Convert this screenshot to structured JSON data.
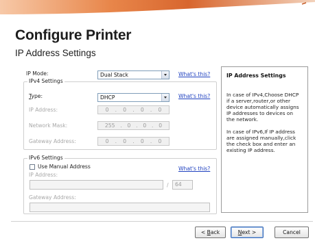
{
  "page": {
    "title": "Configure Printer",
    "subtitle": "IP Address Settings"
  },
  "ip_mode": {
    "label": "IP Mode:",
    "value": "Dual Stack",
    "help_link": "What's this?"
  },
  "ipv4": {
    "group_title": "IPv4 Settings",
    "type_label": "Type:",
    "type_value": "DHCP",
    "help_link": "What's this?",
    "ip_address_label": "IP Address:",
    "ip_address": [
      "0",
      "0",
      "0",
      "0"
    ],
    "netmask_label": "Network Mask:",
    "netmask": [
      "255",
      "0",
      "0",
      "0"
    ],
    "gateway_label": "Gateway Address:",
    "gateway": [
      "0",
      "0",
      "0",
      "0"
    ]
  },
  "ipv6": {
    "group_title": "IPv6 Settings",
    "manual_label": "Use Manual Address",
    "manual_checked": false,
    "help_link": "What's this?",
    "ip_address_label": "IP Address:",
    "ip_address_value": "",
    "prefix_separator": "/",
    "prefix_value": "64",
    "gateway_label": "Gateway Address:",
    "gateway_value": ""
  },
  "info": {
    "title": "IP Address Settings",
    "para1": "In case of IPv4,Choose DHCP if a server,router,or other device automatically assigns IP addresses to devices on the network.",
    "para2": "In case of IPv6,If IP address are assigned manually,click the check box and enter an existing IP address."
  },
  "footer": {
    "back": "< Back",
    "next": "Next >",
    "cancel": "Cancel"
  },
  "colors": {
    "accent_swoosh": "#e07a3a",
    "link": "#1d3fbf"
  }
}
